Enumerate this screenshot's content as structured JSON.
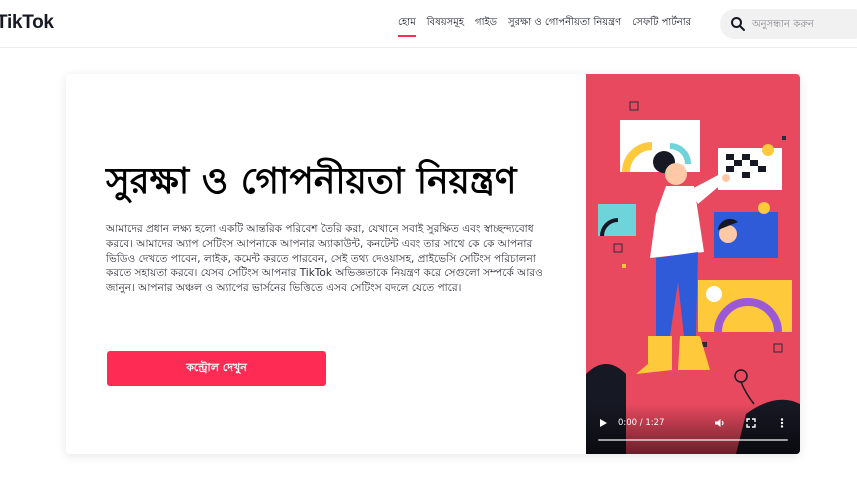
{
  "header": {
    "logo": "TikTok",
    "nav": [
      {
        "label": "হোম",
        "active": true
      },
      {
        "label": "বিষয়সমূহ",
        "active": false
      },
      {
        "label": "গাইড",
        "active": false
      },
      {
        "label": "সুরক্ষা ও গোপনীয়তা নিয়ন্ত্রণ",
        "active": false
      },
      {
        "label": "সেফটি পার্টনার",
        "active": false
      }
    ],
    "search": {
      "placeholder": "অনুসন্ধান করুন"
    }
  },
  "hero": {
    "title": "সুরক্ষা ও গোপনীয়তা নিয়ন্ত্রণ",
    "body": "আমাদের প্রধান লক্ষ্য হলো একটি আন্তরিক পরিবেশ তৈরি করা, যেখানে সবাই সুরক্ষিত এবং স্বাচ্ছন্দ্যবোধ করবে। আমাদের অ্যাপ সেটিংস আপনাকে আপনার অ্যাকাউন্ট, কনটেন্ট এবং তার সাথে কে কে আপনার ভিডিও দেখতে পাবেন, লাইক, কমেন্ট করতে পারবেন, সেই তথ্য দেওয়াসহ, প্রাইভেসি সেটিংস পরিচালনা করতে সহায়তা করবে। যেসব সেটিংস আপনার TikTok অভিজ্ঞতাকে নিয়ন্ত্রণ করে সেগুলো সম্পর্কে আরও জানুন। আপনার অঞ্চল ও অ্যাপের ভার্সনের ভিত্তিতে এসব সেটিংস বদলে যেতে পারে।",
    "cta": "কন্ট্রোল দেখুন"
  },
  "video": {
    "time": "0:00 / 1:27",
    "progress": 0,
    "icons": [
      "play-icon",
      "volume-icon",
      "fullscreen-icon",
      "more-icon"
    ],
    "colors": {
      "background": "#e8495f",
      "accent_yellow": "#ffc93c",
      "accent_blue": "#2f5bd9",
      "accent_purple": "#9b59d6"
    }
  },
  "colors": {
    "brand": "#fe2c55",
    "text": "#161823"
  }
}
